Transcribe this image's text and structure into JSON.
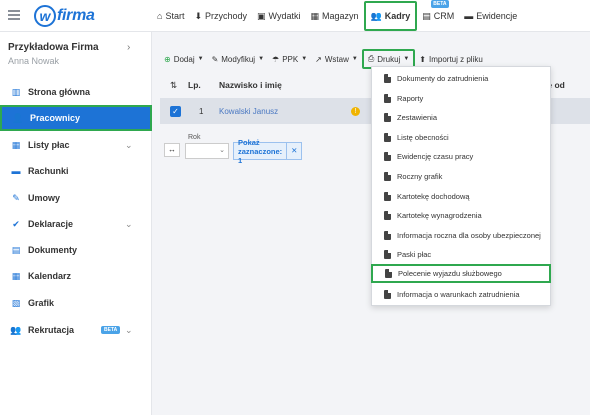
{
  "topbar": {
    "logo_text": "firma",
    "logo_letter": "w",
    "nav": [
      {
        "icon": "home-icon",
        "glyph": "⌂",
        "label": "Start"
      },
      {
        "icon": "income-icon",
        "glyph": "⬇",
        "label": "Przychody"
      },
      {
        "icon": "wallet-icon",
        "glyph": "▣",
        "label": "Wydatki"
      },
      {
        "icon": "warehouse-icon",
        "glyph": "▦",
        "label": "Magazyn"
      },
      {
        "icon": "people-icon",
        "glyph": "👥",
        "label": "Kadry"
      },
      {
        "icon": "crm-icon",
        "glyph": "▤",
        "label": "CRM",
        "badge": "BETA"
      },
      {
        "icon": "folder-icon",
        "glyph": "▬",
        "label": "Ewidencje"
      }
    ]
  },
  "sidebar": {
    "company": "Przykładowa Firma",
    "user": "Anna Nowak",
    "items": [
      {
        "label": "Strona główna",
        "glyph": "▥",
        "icon": "dashboard-icon"
      },
      {
        "label": "Pracownicy",
        "glyph": "👤",
        "icon": "user-plus-icon"
      },
      {
        "label": "Listy płac",
        "glyph": "▦",
        "icon": "calculator-icon",
        "chevron": true
      },
      {
        "label": "Rachunki",
        "glyph": "▬",
        "icon": "receipt-icon"
      },
      {
        "label": "Umowy",
        "glyph": "✎",
        "icon": "contract-icon"
      },
      {
        "label": "Deklaracje",
        "glyph": "✔",
        "icon": "declaration-icon",
        "chevron": true
      },
      {
        "label": "Dokumenty",
        "glyph": "▤",
        "icon": "documents-icon"
      },
      {
        "label": "Kalendarz",
        "glyph": "▦",
        "icon": "calendar-icon"
      },
      {
        "label": "Grafik",
        "glyph": "▧",
        "icon": "schedule-icon"
      },
      {
        "label": "Rekrutacja",
        "glyph": "👥",
        "icon": "recruitment-icon",
        "badge": "BETA",
        "chevron": true
      }
    ]
  },
  "toolbar": {
    "add": "Dodaj",
    "modify": "Modyfikuj",
    "ppk": "PPK",
    "insert": "Wstaw",
    "print": "Drukuj",
    "import": "Importuj z pliku"
  },
  "table": {
    "col_lp": "Lp.",
    "col_name": "Nazwisko i imię",
    "col_partial": "ie od",
    "rows": [
      {
        "lp": "1",
        "name": "Kowalski Janusz"
      }
    ]
  },
  "filter": {
    "year_label": "Rok",
    "show_selected": "Pokaż zaznaczone: 1"
  },
  "print_menu": [
    "Dokumenty do zatrudnienia",
    "Raporty",
    "Zestawienia",
    "Listę obecności",
    "Ewidencję czasu pracy",
    "Roczny grafik",
    "Kartotekę dochodową",
    "Kartotekę wynagrodzenia",
    "Informacja roczna dla osoby ubezpieczonej",
    "Paski płac",
    "Polecenie wyjazdu służbowego",
    "Informacja o warunkach zatrudnienia"
  ],
  "colors": {
    "accent": "#1d73d6",
    "highlight": "#2fa84f"
  }
}
